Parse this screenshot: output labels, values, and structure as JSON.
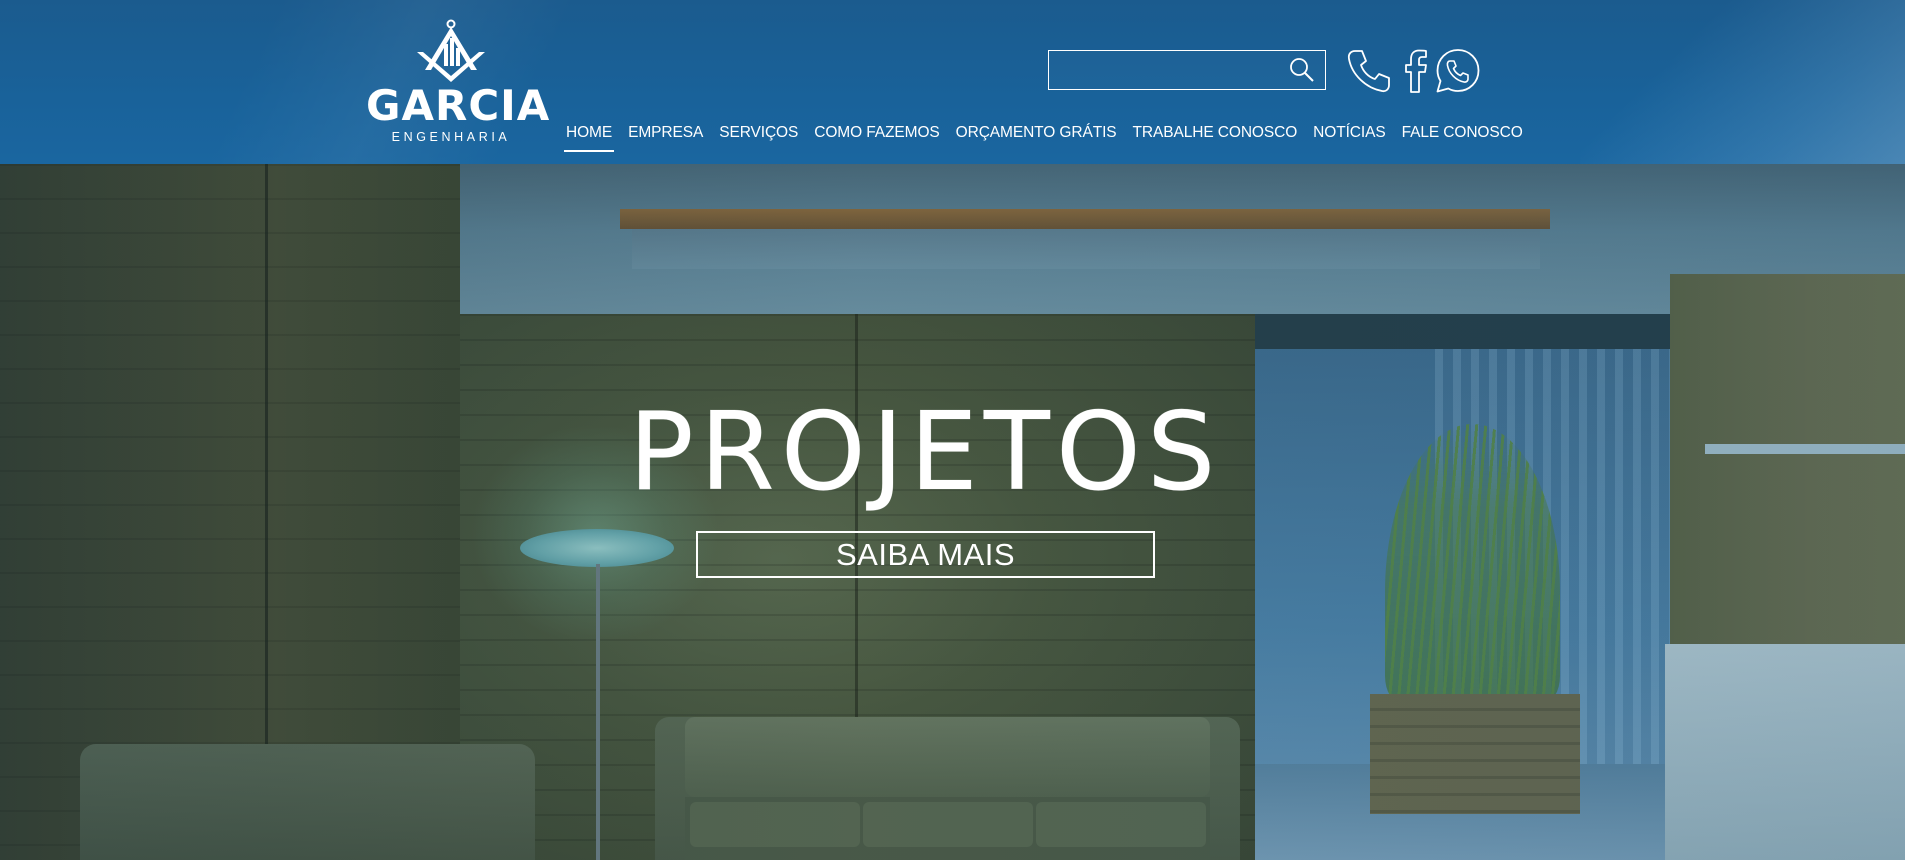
{
  "header": {
    "logo": {
      "brand": "GARCIA",
      "tagline": "ENGENHARIA",
      "emblem_icon": "compass-square-emblem-icon"
    },
    "search": {
      "placeholder": "",
      "value": "",
      "icon": "search-icon"
    },
    "social": [
      {
        "name": "phone",
        "icon": "phone-icon"
      },
      {
        "name": "facebook",
        "icon": "facebook-icon"
      },
      {
        "name": "whatsapp",
        "icon": "whatsapp-icon"
      }
    ],
    "nav": [
      {
        "label": "HOME",
        "active": true
      },
      {
        "label": "EMPRESA",
        "active": false
      },
      {
        "label": "SERVIÇOS",
        "active": false
      },
      {
        "label": "COMO FAZEMOS",
        "active": false
      },
      {
        "label": "ORÇAMENTO GRÁTIS",
        "active": false
      },
      {
        "label": "TRABALHE CONOSCO",
        "active": false
      },
      {
        "label": "NOTÍCIAS",
        "active": false
      },
      {
        "label": "FALE CONOSCO",
        "active": false
      }
    ]
  },
  "hero": {
    "title": "PROJETOS",
    "button_label": "SAIBA MAIS"
  },
  "colors": {
    "header_bg": "#19629a",
    "text": "#ffffff"
  }
}
